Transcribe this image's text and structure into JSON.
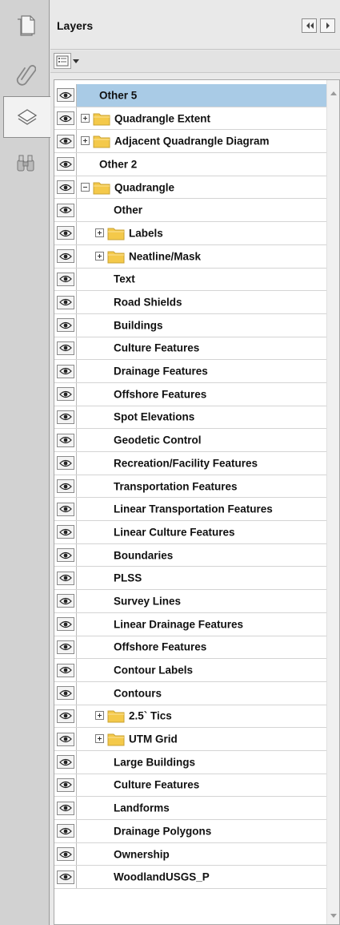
{
  "panel": {
    "title": "Layers"
  },
  "toolstrip": {
    "items": [
      {
        "icon": "page-thumbnails-icon"
      },
      {
        "icon": "attachments-paperclip-icon"
      },
      {
        "icon": "layers-icon",
        "active": true
      },
      {
        "icon": "binoculars-search-icon"
      }
    ]
  },
  "colors": {
    "selected_row": "#a9cbe6",
    "folder": "#f4c94a"
  },
  "layers": [
    {
      "label": "Other 5",
      "indent": 0,
      "folder": false,
      "expander": "none",
      "selected": true
    },
    {
      "label": "Quadrangle Extent",
      "indent": 0,
      "folder": true,
      "expander": "plus"
    },
    {
      "label": "Adjacent Quadrangle Diagram",
      "indent": 0,
      "folder": true,
      "expander": "plus"
    },
    {
      "label": "Other 2",
      "indent": 0,
      "folder": false,
      "expander": "none"
    },
    {
      "label": "Quadrangle",
      "indent": 0,
      "folder": true,
      "expander": "minus"
    },
    {
      "label": "Other",
      "indent": 1,
      "folder": false,
      "expander": "none"
    },
    {
      "label": "Labels",
      "indent": 1,
      "folder": true,
      "expander": "plus"
    },
    {
      "label": "Neatline/Mask",
      "indent": 1,
      "folder": true,
      "expander": "plus"
    },
    {
      "label": "Text",
      "indent": 1,
      "folder": false,
      "expander": "none"
    },
    {
      "label": "Road Shields",
      "indent": 1,
      "folder": false,
      "expander": "none"
    },
    {
      "label": "Buildings",
      "indent": 1,
      "folder": false,
      "expander": "none"
    },
    {
      "label": "Culture Features",
      "indent": 1,
      "folder": false,
      "expander": "none"
    },
    {
      "label": "Drainage Features",
      "indent": 1,
      "folder": false,
      "expander": "none"
    },
    {
      "label": "Offshore Features",
      "indent": 1,
      "folder": false,
      "expander": "none"
    },
    {
      "label": "Spot Elevations",
      "indent": 1,
      "folder": false,
      "expander": "none"
    },
    {
      "label": "Geodetic Control",
      "indent": 1,
      "folder": false,
      "expander": "none"
    },
    {
      "label": "Recreation/Facility Features",
      "indent": 1,
      "folder": false,
      "expander": "none"
    },
    {
      "label": "Transportation Features",
      "indent": 1,
      "folder": false,
      "expander": "none"
    },
    {
      "label": "Linear Transportation Features",
      "indent": 1,
      "folder": false,
      "expander": "none"
    },
    {
      "label": "Linear Culture Features",
      "indent": 1,
      "folder": false,
      "expander": "none"
    },
    {
      "label": "Boundaries",
      "indent": 1,
      "folder": false,
      "expander": "none"
    },
    {
      "label": "PLSS",
      "indent": 1,
      "folder": false,
      "expander": "none"
    },
    {
      "label": "Survey Lines",
      "indent": 1,
      "folder": false,
      "expander": "none"
    },
    {
      "label": "Linear Drainage Features",
      "indent": 1,
      "folder": false,
      "expander": "none"
    },
    {
      "label": "Offshore Features",
      "indent": 1,
      "folder": false,
      "expander": "none"
    },
    {
      "label": "Contour Labels",
      "indent": 1,
      "folder": false,
      "expander": "none"
    },
    {
      "label": "Contours",
      "indent": 1,
      "folder": false,
      "expander": "none"
    },
    {
      "label": "2.5` Tics",
      "indent": 1,
      "folder": true,
      "expander": "plus"
    },
    {
      "label": "UTM Grid",
      "indent": 1,
      "folder": true,
      "expander": "plus"
    },
    {
      "label": "Large Buildings",
      "indent": 1,
      "folder": false,
      "expander": "none"
    },
    {
      "label": "Culture Features",
      "indent": 1,
      "folder": false,
      "expander": "none"
    },
    {
      "label": "Landforms",
      "indent": 1,
      "folder": false,
      "expander": "none"
    },
    {
      "label": "Drainage Polygons",
      "indent": 1,
      "folder": false,
      "expander": "none"
    },
    {
      "label": "Ownership",
      "indent": 1,
      "folder": false,
      "expander": "none"
    },
    {
      "label": "WoodlandUSGS_P",
      "indent": 1,
      "folder": false,
      "expander": "none"
    }
  ]
}
